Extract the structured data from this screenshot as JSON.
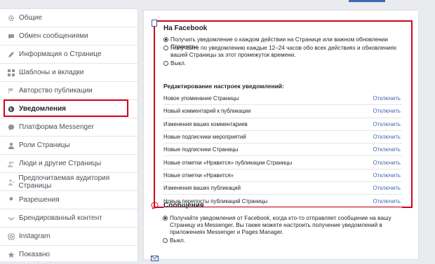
{
  "sidebar": {
    "items": [
      {
        "label": "Общие",
        "icon": "gear-icon"
      },
      {
        "label": "Обмен сообщениями",
        "icon": "chat-bubble-icon"
      },
      {
        "label": "Информация о Странице",
        "icon": "pencil-icon"
      },
      {
        "label": "Шаблоны и вкладки",
        "icon": "grid-icon"
      },
      {
        "label": "Авторство публикации",
        "icon": "flag-icon"
      },
      {
        "label": "Уведомления",
        "icon": "globe-icon",
        "active": true
      },
      {
        "label": "Платформа Messenger",
        "icon": "messenger-icon"
      },
      {
        "label": "Роли Страницы",
        "icon": "person-icon"
      },
      {
        "label": "Люди и другие Страницы",
        "icon": "people-icon"
      },
      {
        "label": "Предпочитаемая аудитория Страницы",
        "icon": "audience-icon"
      },
      {
        "label": "Разрешения",
        "icon": "wrench-icon"
      },
      {
        "label": "Брендированный контент",
        "icon": "handshake-icon"
      },
      {
        "label": "Instagram",
        "icon": "instagram-icon"
      },
      {
        "label": "Показано",
        "icon": "star-icon"
      }
    ]
  },
  "facebook_section": {
    "title": "На Facebook",
    "options": [
      {
        "label": "Получать уведомление о каждом действии на Странице или важном обновлении Страницы.",
        "selected": true
      },
      {
        "label": "Получайте по уведомлению каждые 12–24 часов обо всех действиях и обновлениях вашей Страницы за этот промежуток времени.",
        "selected": false
      },
      {
        "label": "Выкл.",
        "selected": false
      }
    ],
    "edit_title": "Редактирование настроек уведомлений:",
    "off_label": "Отключить",
    "notifications": [
      "Новое упоминание Страницы",
      "Новый комментарий к публикации",
      "Изменения ваших комментариев",
      "Новые подписчики мероприятий",
      "Новые подписчики Страницы",
      "Новые отметки «Нравится» публикации Страницы",
      "Новые отметки «Нравится»",
      "Изменения ваших публикаций",
      "Новые перепосты публикаций Страницы"
    ]
  },
  "messages_section": {
    "title": "Сообщения",
    "options": [
      {
        "label": "Получайте уведомления от Facebook, когда кто-то отправляет сообщение на вашу Страницу из Messenger. Вы также можете настроить получение уведомлений в приложениях Messenger и Pages Manager.",
        "selected": true
      },
      {
        "label": "Выкл.",
        "selected": false
      }
    ]
  },
  "colors": {
    "accent": "#4267b2",
    "highlight": "#d0021b"
  }
}
